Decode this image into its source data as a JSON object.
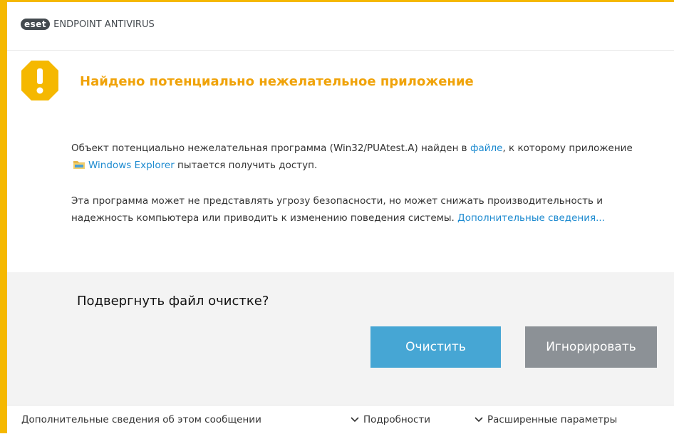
{
  "colors": {
    "accent": "#f5b800",
    "title": "#f0a30a",
    "link": "#1e8bd0",
    "primary_button": "#46a6d4",
    "secondary_button": "#8c9196",
    "panel_bg": "#f3f3f3"
  },
  "header": {
    "logo_badge": "eset",
    "logo_text": "ENDPOINT ANTIVIRUS"
  },
  "alert": {
    "icon": "warning-octagon-icon",
    "title": "Найдено потенциально нежелательное приложение",
    "para1_part1": "Объект потенциально нежелательная программа (Win32/PUAtest.A) найден в ",
    "para1_link_file": "файле",
    "para1_part2": ", к которому приложение ",
    "app_icon": "folder-icon",
    "para1_link_app": "Windows Explorer",
    "para1_part3": "  пытается получить доступ.",
    "para2_text": "Эта программа может не представлять угрозу безопасности, но может снижать производительность и надежность компьютера или приводить к изменению поведения системы. ",
    "para2_link": "Дополнительные сведения..."
  },
  "action": {
    "question": "Подвергнуть файл очистке?",
    "clean_label": "Очистить",
    "ignore_label": "Игнорировать"
  },
  "footer": {
    "info_label": "Дополнительные сведения об этом сообщении",
    "details_label": "Подробности",
    "advanced_label": "Расширенные параметры"
  }
}
